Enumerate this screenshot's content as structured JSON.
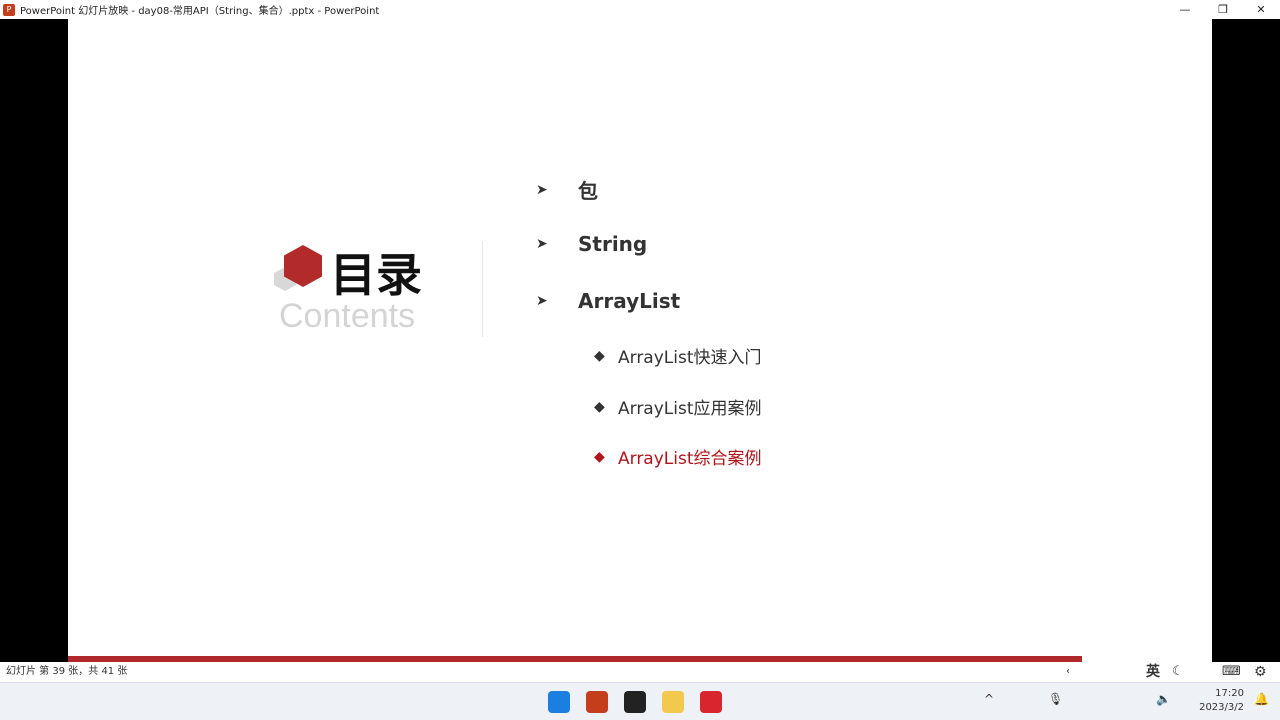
{
  "window": {
    "title": "PowerPoint 幻灯片放映  -  day08-常用API（String、集合）.pptx - PowerPoint",
    "app_icon": "P"
  },
  "slide": {
    "title_cn": "目录",
    "title_en": "Contents",
    "items": [
      {
        "label": "包",
        "level": 1
      },
      {
        "label": "String",
        "level": 1
      },
      {
        "label": "ArrayList",
        "level": 1
      },
      {
        "label": "ArrayList快速入门",
        "level": 2
      },
      {
        "label": "ArrayList应用案例",
        "level": 2
      },
      {
        "label": "ArrayList综合案例",
        "level": 2,
        "active": true
      }
    ],
    "accent": "#b0282a"
  },
  "status": {
    "slide_info": "幻灯片 第 39 张，共 41 张"
  },
  "ime": {
    "lang": "英"
  },
  "clock": {
    "time": "17:20",
    "date": "2023/3/2"
  }
}
